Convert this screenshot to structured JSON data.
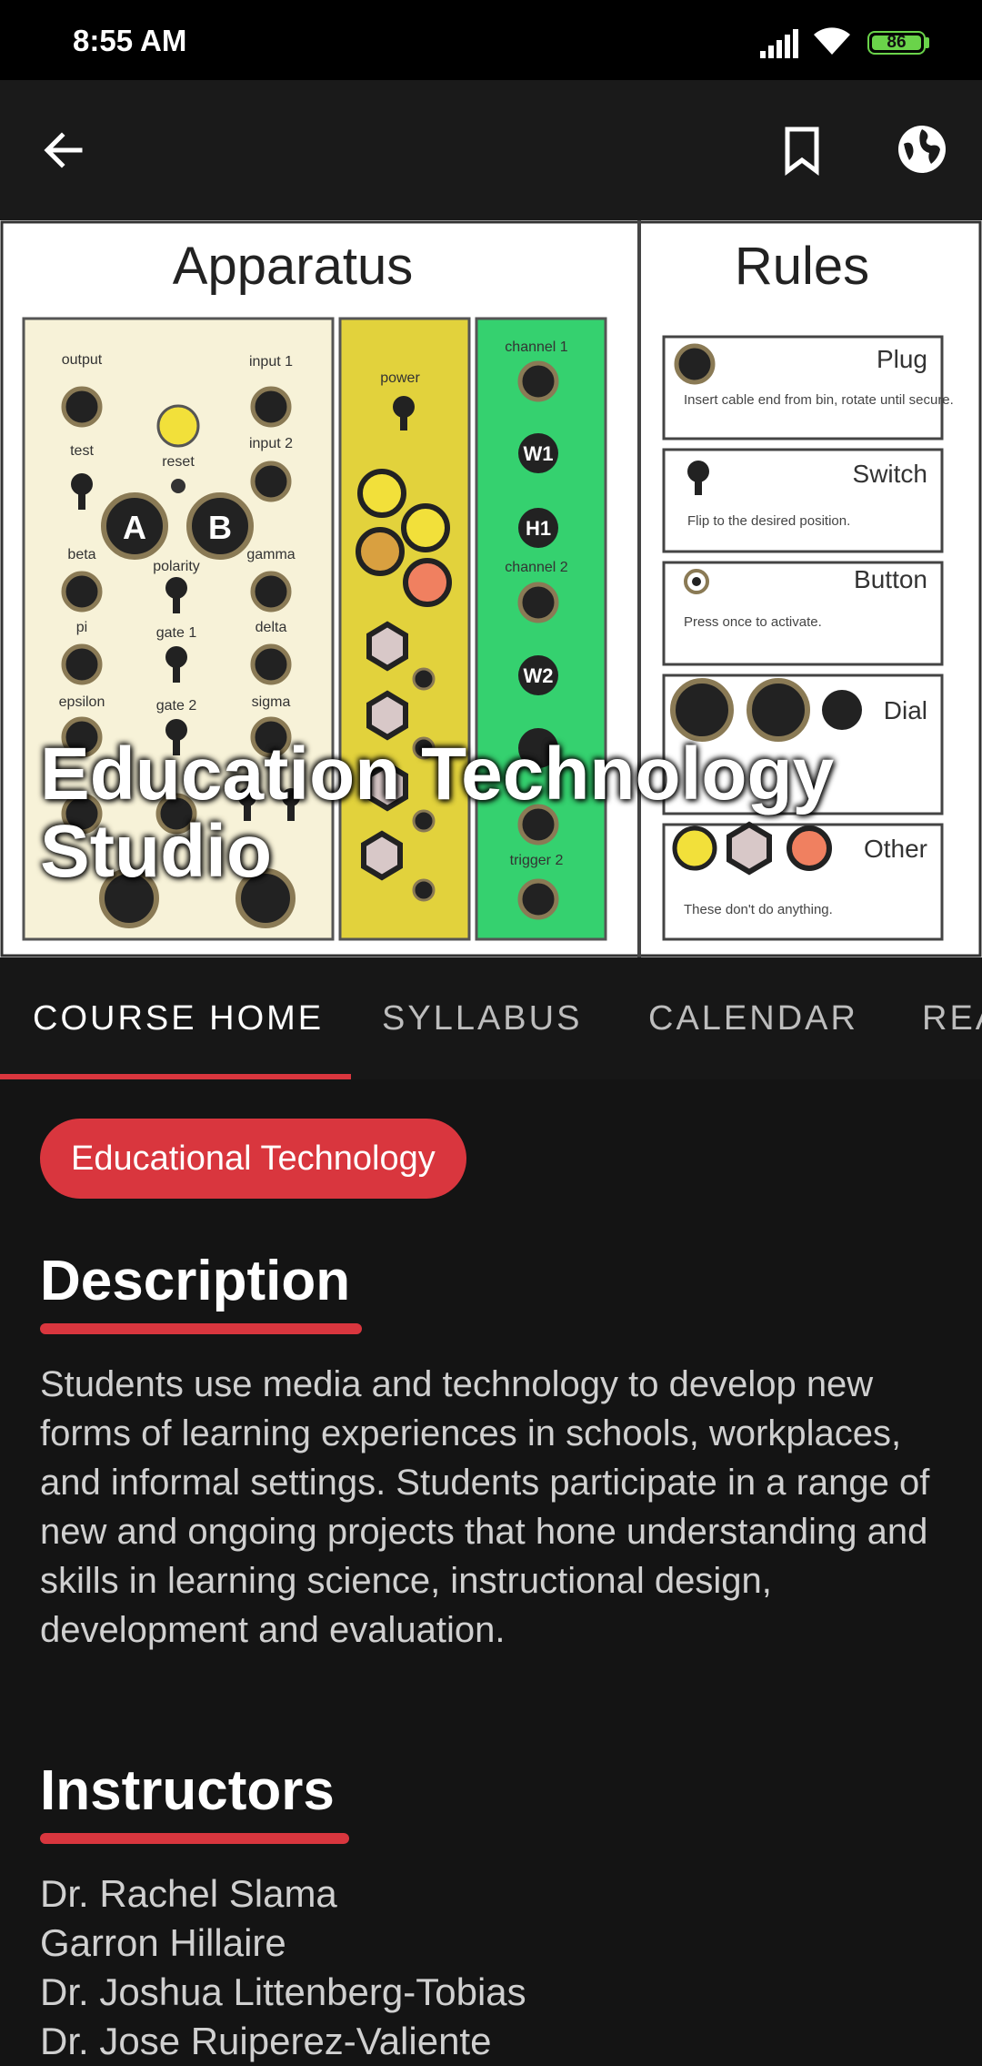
{
  "status_bar": {
    "time": "8:55 AM",
    "battery": "86"
  },
  "hero": {
    "title_line1": "Education Technology",
    "title_line2": "Studio",
    "image": {
      "apparatus_title": "Apparatus",
      "rules_title": "Rules",
      "labels": {
        "output": "output",
        "input1": "input 1",
        "test": "test",
        "reset": "reset",
        "input2": "input 2",
        "beta": "beta",
        "polarity": "polarity",
        "gamma": "gamma",
        "pi": "pi",
        "gate1": "gate 1",
        "delta": "delta",
        "epsilon": "epsilon",
        "gate2": "gate 2",
        "sigma": "sigma",
        "power": "power",
        "channel1": "channel 1",
        "channel2": "channel 2",
        "trigger2": "trigger 2",
        "a": "A",
        "b": "B",
        "w1": "W1",
        "h1": "H1",
        "w2": "W2"
      },
      "rules": {
        "plug_title": "Plug",
        "plug_text": "Insert cable end from bin, rotate until secure.",
        "switch_title": "Switch",
        "switch_text": "Flip to the desired position.",
        "button_title": "Button",
        "button_text": "Press once to activate.",
        "dial_title": "Dial",
        "other_title": "Other",
        "other_text": "These don't do anything."
      }
    }
  },
  "tabs": [
    {
      "label": "COURSE HOME",
      "active": true
    },
    {
      "label": "SYLLABUS",
      "active": false
    },
    {
      "label": "CALENDAR",
      "active": false
    },
    {
      "label": "REA",
      "active": false
    }
  ],
  "chip": "Educational Technology",
  "description": {
    "heading": "Description",
    "text": "Students use media and technology to develop new forms of learning experiences in schools, workplaces, and informal settings. Students participate in a range of new and ongoing projects that hone understanding and skills in learning science, instructional design, development and evaluation."
  },
  "instructors": {
    "heading": "Instructors",
    "names": [
      "Dr. Rachel Slama",
      "Garron Hillaire",
      "Dr. Joshua Littenberg-Tobias",
      "Dr. Jose Ruiperez-Valiente"
    ]
  },
  "colors": {
    "accent": "#d9363e",
    "background": "#141414",
    "battery": "#6ad34a"
  }
}
